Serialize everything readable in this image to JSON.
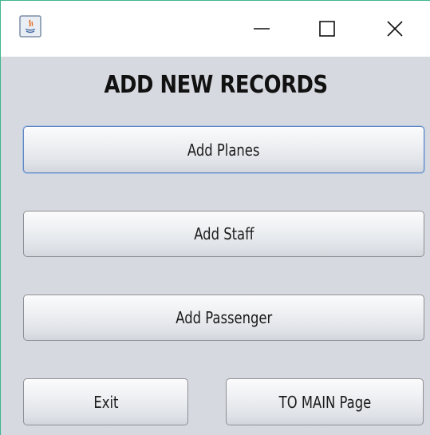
{
  "window": {
    "app_icon": "java-icon",
    "controls": {
      "minimize_icon": "minimize-icon",
      "maximize_icon": "maximize-icon",
      "close_icon": "close-icon"
    }
  },
  "heading": "ADD NEW RECORDS",
  "buttons": {
    "add_planes": "Add Planes",
    "add_staff": "Add Staff",
    "add_passenger": "Add Passenger",
    "exit": "Exit",
    "to_main": "TO MAIN Page"
  },
  "colors": {
    "window_bg": "#d6d9df",
    "focus_border": "#5f86bf",
    "accent_edge": "#3fb68e"
  }
}
